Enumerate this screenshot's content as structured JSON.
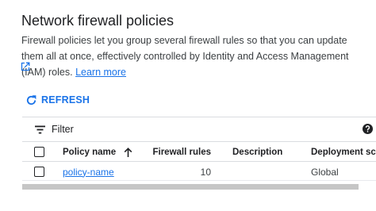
{
  "page": {
    "title": "Network firewall policies",
    "description": "Firewall policies let you group several firewall rules so that you can update them all at once, effectively controlled by Identity and Access Management (IAM) roles.",
    "learn_more": "Learn more"
  },
  "toolbar": {
    "refresh_label": "REFRESH",
    "filter_label": "Filter"
  },
  "table": {
    "columns": {
      "policy_name": "Policy name",
      "firewall_rules": "Firewall rules",
      "description": "Description",
      "deployment_scope": "Deployment scope"
    },
    "rows": [
      {
        "policy_name": "policy-name",
        "firewall_rules": "10",
        "description": "",
        "deployment_scope": "Global"
      }
    ]
  },
  "colors": {
    "accent": "#1a73e8",
    "text": "#202124",
    "border": "#dadce0"
  },
  "icons": [
    "external-link-icon",
    "refresh-icon",
    "filter-icon",
    "help-icon",
    "sort-ascending-icon"
  ]
}
